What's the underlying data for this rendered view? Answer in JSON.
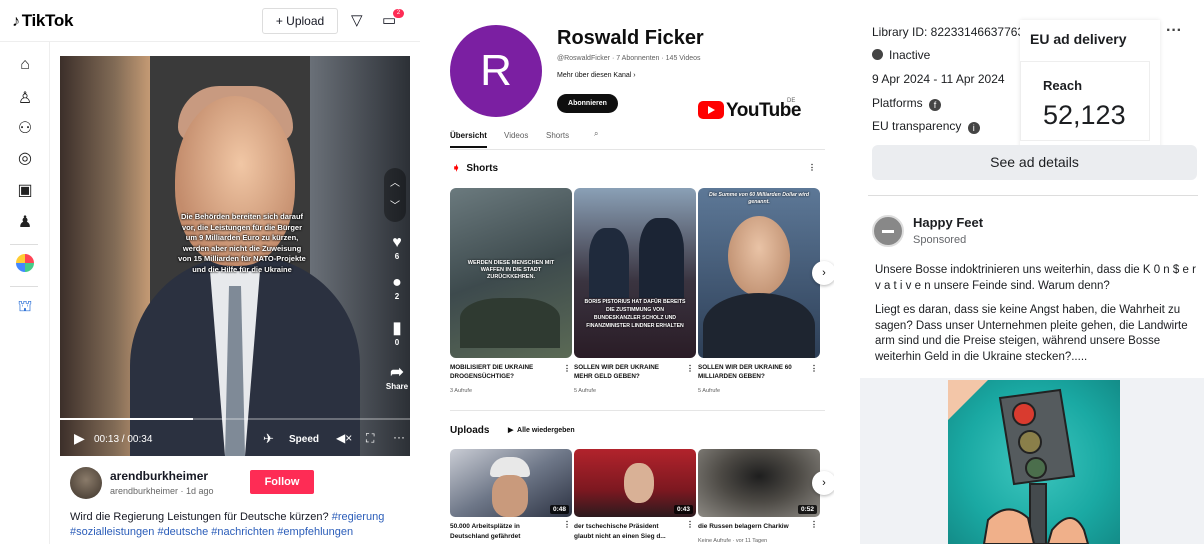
{
  "tiktok": {
    "logo": "TikTok",
    "upload_label": "+ Upload",
    "inbox_count": "2",
    "caption_lines": [
      "Die Behörden bereiten sich darauf",
      "vor, die Leistungen für die Bürger",
      "um 9 Milliarden Euro zu kürzen,",
      "werden aber nicht die Zuweisung",
      "von 15 Milliarden für NATO-Projekte",
      "und die Hilfe für die Ukraine"
    ],
    "likes": "6",
    "comments": "2",
    "saves": "0",
    "share_label": "Share",
    "time": "00:13 / 00:34",
    "progress": 0.38,
    "speed_label": "Speed",
    "username": "arendburkheimer",
    "handle_date": "arendburkheimer · 1d ago",
    "follow_label": "Follow",
    "description": "Wird die Regierung Leistungen für Deutsche kürzen?",
    "hashtags_line1": "#regierung",
    "hashtags_line2": "#sozialleistungen #deutsche #nachrichten #empfehlungen"
  },
  "youtube": {
    "avatar_letter": "R",
    "channel_name": "Roswald Ficker",
    "meta": "@RoswaldFicker · 7 Abonnenten · 145 Videos",
    "more_about": "Mehr über diesen Kanal",
    "subscribe_label": "Abonnieren",
    "logo_text": "YouTube",
    "logo_region": "DE",
    "tabs": [
      "Übersicht",
      "Videos",
      "Shorts"
    ],
    "shorts_heading": "Shorts",
    "shorts": [
      {
        "title": "MOBILISIERT DIE UKRAINE DROGENSÜCHTIGE?",
        "views": "3 Aufrufe",
        "overlay": "WERDEN DIESE MENSCHEN MIT WAFFEN IN DIE STADT ZURÜCKKEHREN."
      },
      {
        "title": "SOLLEN WIR DER UKRAINE MEHR GELD GEBEN?",
        "views": "5 Aufrufe",
        "overlay": "BORIS PISTORIUS HAT DAFÜR BEREITS DIE ZUSTIMMUNG VON BUNDESKANZLER SCHOLZ UND FINANZMINISTER LINDNER ERHALTEN"
      },
      {
        "title": "SOLLEN WIR DER UKRAINE 60 MILLIARDEN GEBEN?",
        "views": "5 Aufrufe",
        "overlay": "Die Summe von 60 Milliarden Dollar wird genannt."
      }
    ],
    "uploads_heading": "Uploads",
    "play_all": "Alle wiedergeben",
    "uploads": [
      {
        "title_l1": "50.000 Arbeitsplätze in",
        "title_l2": "Deutschland gefährdet",
        "duration": "0:48",
        "views": ""
      },
      {
        "title_l1": "der tschechische Präsident",
        "title_l2": "glaubt nicht an einen Sieg d...",
        "duration": "0:43",
        "views": ""
      },
      {
        "title_l1": "die Russen belagern Charkiw",
        "title_l2": "",
        "duration": "0:52",
        "views": "Keine Aufrufe · vor 11 Tagen"
      }
    ]
  },
  "adlib": {
    "library_id": "Library ID: 822331466377636",
    "status": "Inactive",
    "dates": "9 Apr 2024 - 11 Apr 2024",
    "platforms": "Platforms",
    "eu_transparency": "EU transparency",
    "delivery_title": "EU ad delivery",
    "reach_label": "Reach",
    "reach_value": "52,123",
    "see_details": "See ad details",
    "page_name": "Happy Feet",
    "sponsored": "Sponsored",
    "body_p1": "Unsere Bosse indoktrinieren uns weiterhin, dass die K 0 n $ e r v a t i v e n unsere Feinde sind. Warum denn?",
    "body_p2": "Liegt es daran, dass sie keine Angst haben, die Wahrheit zu sagen? Dass unser Unternehmen pleite gehen, die Landwirte arm sind und die Preise steigen, während unsere Bosse weiterhin Geld in die Ukraine stecken?....."
  }
}
